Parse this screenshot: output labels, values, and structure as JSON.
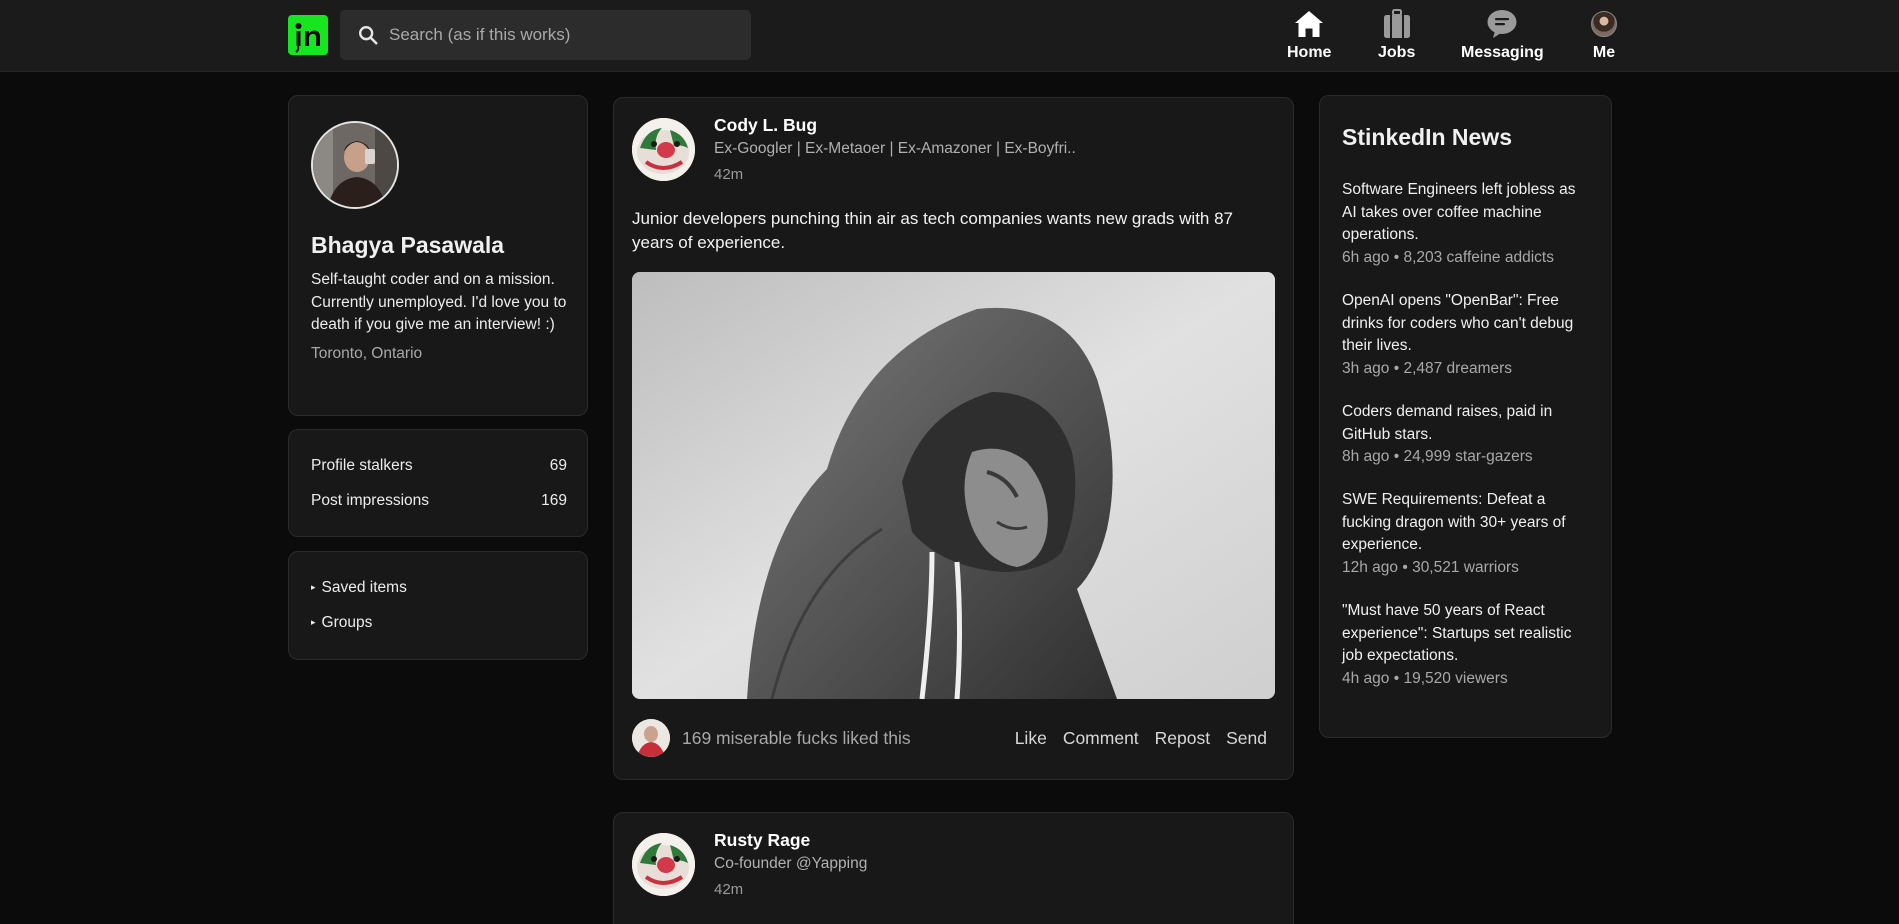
{
  "nav": {
    "logo_icon": "stinkedin-logo-icon",
    "search_placeholder": "Search (as if this works)",
    "items": [
      {
        "label": "Home",
        "icon": "home-icon"
      },
      {
        "label": "Jobs",
        "icon": "briefcase-icon"
      },
      {
        "label": "Messaging",
        "icon": "message-icon"
      },
      {
        "label": "Me",
        "icon": "avatar"
      }
    ],
    "accent": "#17e51f"
  },
  "profile": {
    "name": "Bhagya Pasawala",
    "bio": "Self-taught coder and on a mission. Currently unemployed. I'd love you to death if you give me an interview! :)",
    "location": "Toronto, Ontario"
  },
  "stats": [
    {
      "label": "Profile stalkers",
      "value": "69"
    },
    {
      "label": "Post impressions",
      "value": "169"
    }
  ],
  "links": [
    {
      "label": "Saved items"
    },
    {
      "label": "Groups"
    }
  ],
  "posts": [
    {
      "author": "Cody L. Bug",
      "headline": "Ex-Googler | Ex-Metaoer | Ex-Amazoner | Ex-Boyfri..",
      "time": "42m",
      "text": "Junior developers punching thin air as tech companies wants new grads with 87 years of experience.",
      "likes_text": "169 miserable fucks liked this",
      "actions": [
        "Like",
        "Comment",
        "Repost",
        "Send"
      ]
    },
    {
      "author": "Rusty Rage",
      "headline": "Co-founder @Yapping",
      "time": "42m"
    }
  ],
  "news": {
    "title": "StinkedIn News",
    "items": [
      {
        "headline": "Software Engineers left jobless as AI takes over coffee machine operations.",
        "meta": "6h ago • 8,203 caffeine addicts"
      },
      {
        "headline": "OpenAI opens \"OpenBar\": Free drinks for coders who can't debug their lives.",
        "meta": "3h ago • 2,487 dreamers"
      },
      {
        "headline": "Coders demand raises, paid in GitHub stars.",
        "meta": "8h ago • 24,999 star-gazers"
      },
      {
        "headline": "SWE Requirements: Defeat a fucking dragon with 30+ years of experience.",
        "meta": "12h ago • 30,521 warriors"
      },
      {
        "headline": "\"Must have 50 years of React experience\": Startups set realistic job expectations.",
        "meta": "4h ago • 19,520 viewers"
      }
    ]
  }
}
